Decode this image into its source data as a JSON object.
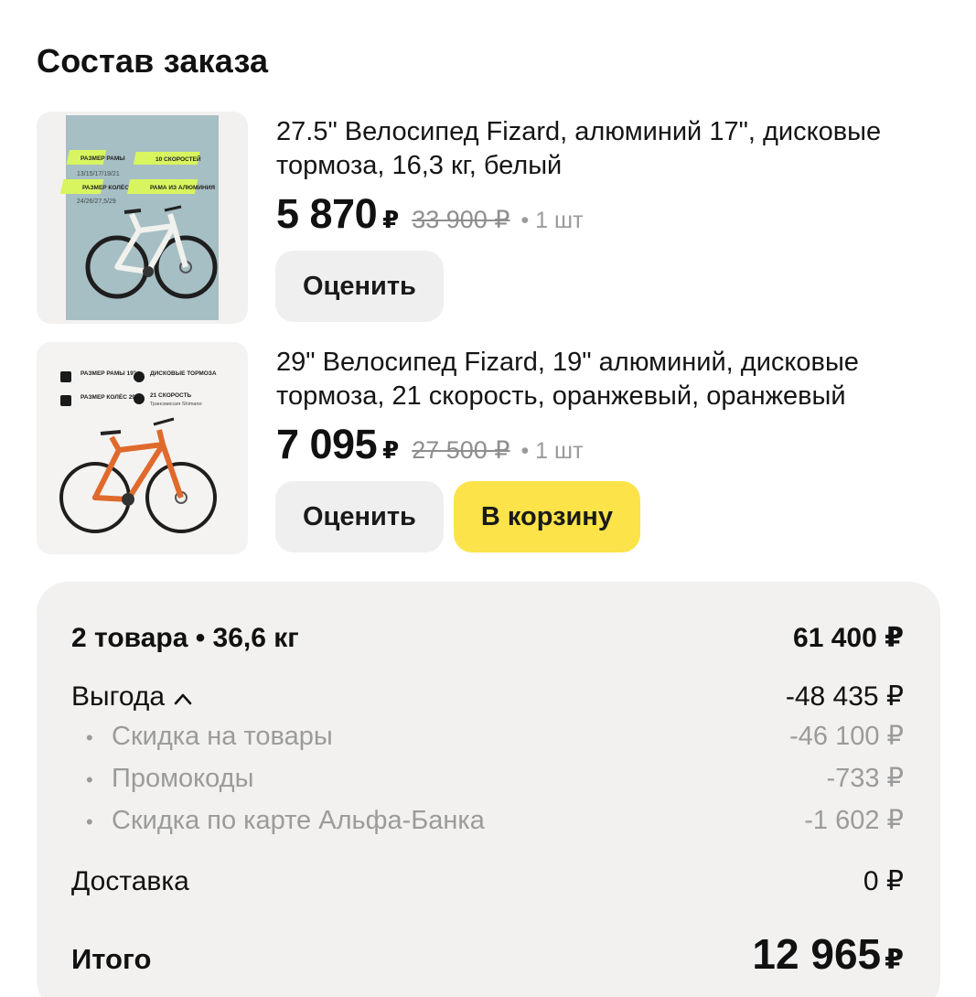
{
  "page_title": "Состав заказа",
  "items": [
    {
      "name": "27.5\" Велосипед Fizard, алюминий 17\", дисковые тормоза, 16,3 кг, белый",
      "price": "5 870",
      "currency": "₽",
      "old_price": "33 900 ₽",
      "qty": "• 1 шт",
      "rate_button": "Оценить",
      "thumb_labels": {
        "frame_size": "РАЗМЕР РАМЫ",
        "frame_values": "13/15/17/19/21",
        "speeds": "10 СКОРОСТЕЙ",
        "wheel_size": "РАЗМЕР КОЛЁС",
        "wheel_values": "24/26/27,5/29",
        "material": "РАМА ИЗ АЛЮМИНИЯ"
      },
      "frame_color": "#f1f1ee"
    },
    {
      "name": "29\" Велосипед Fizard, 19\" алюминий, дисковые тормоза, 21 скорость, оранжевый, оранжевый",
      "price": "7 095",
      "currency": "₽",
      "old_price": "27 500 ₽",
      "qty": "• 1 шт",
      "rate_button": "Оценить",
      "cart_button": "В корзину",
      "thumb_labels": {
        "frame_size": "РАЗМЕР РАМЫ 19\"",
        "wheel_size": "РАЗМЕР КОЛЁС 29\"",
        "brakes": "ДИСКОВЫЕ ТОРМОЗА",
        "speeds": "21 СКОРОСТЬ",
        "transmission": "Трансмиссия Shimano"
      },
      "frame_color": "#e06a2c"
    }
  ],
  "summary": {
    "items_label": "2 товара • 36,6 кг",
    "items_value": "61 400 ₽",
    "benefit_label": "Выгода",
    "benefit_value": "-48 435 ₽",
    "discounts": [
      {
        "label": "Скидка на товары",
        "value": "-46 100 ₽"
      },
      {
        "label": "Промокоды",
        "value": "-733 ₽"
      },
      {
        "label": "Скидка по карте Альфа-Банка",
        "value": "-1 602 ₽"
      }
    ],
    "delivery_label": "Доставка",
    "delivery_value": "0 ₽",
    "total_label": "Итого",
    "total_value": "12 965",
    "total_currency": "₽"
  },
  "colors": {
    "accent_yellow": "#fce349",
    "card_bg": "#f2f1ef",
    "muted_text": "#9b9b9b"
  }
}
